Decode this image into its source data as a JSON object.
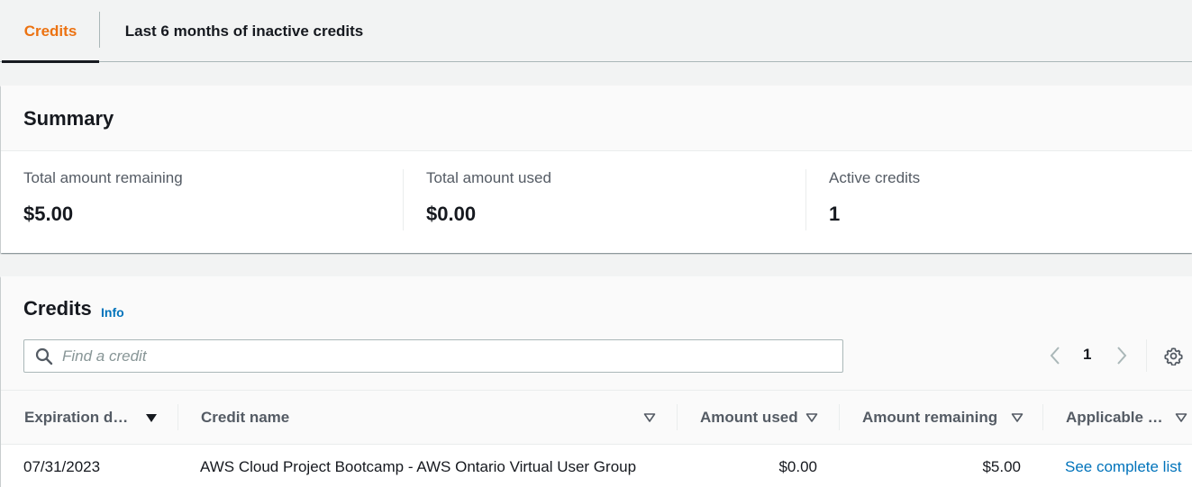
{
  "tabs": [
    {
      "label": "Credits",
      "active": true
    },
    {
      "label": "Last 6 months of inactive credits",
      "active": false
    }
  ],
  "summary": {
    "title": "Summary",
    "stats": [
      {
        "label": "Total amount remaining",
        "value": "$5.00"
      },
      {
        "label": "Total amount used",
        "value": "$0.00"
      },
      {
        "label": "Active credits",
        "value": "1"
      }
    ]
  },
  "credits": {
    "title": "Credits",
    "info_label": "Info",
    "search": {
      "placeholder": "Find a credit",
      "value": ""
    },
    "pagination": {
      "current_page": "1"
    },
    "columns": [
      {
        "label": "Expiration d…",
        "sorted": "descending"
      },
      {
        "label": "Credit name"
      },
      {
        "label": "Amount used"
      },
      {
        "label": "Amount remaining"
      },
      {
        "label": "Applicable …"
      }
    ],
    "rows": [
      {
        "expiration": "07/31/2023",
        "credit_name": "AWS Cloud Project Bootcamp - AWS Ontario Virtual User Group",
        "amount_used": "$0.00",
        "amount_remaining": "$5.00",
        "applicable": "See complete list"
      }
    ]
  },
  "colors": {
    "accent": "#ec7211",
    "link": "#0073bb",
    "text": "#16191f",
    "muted": "#545b64"
  },
  "icons": [
    "search-icon",
    "chevron-left-icon",
    "chevron-right-icon",
    "gear-icon",
    "sort-descending-icon",
    "sort-icon"
  ]
}
